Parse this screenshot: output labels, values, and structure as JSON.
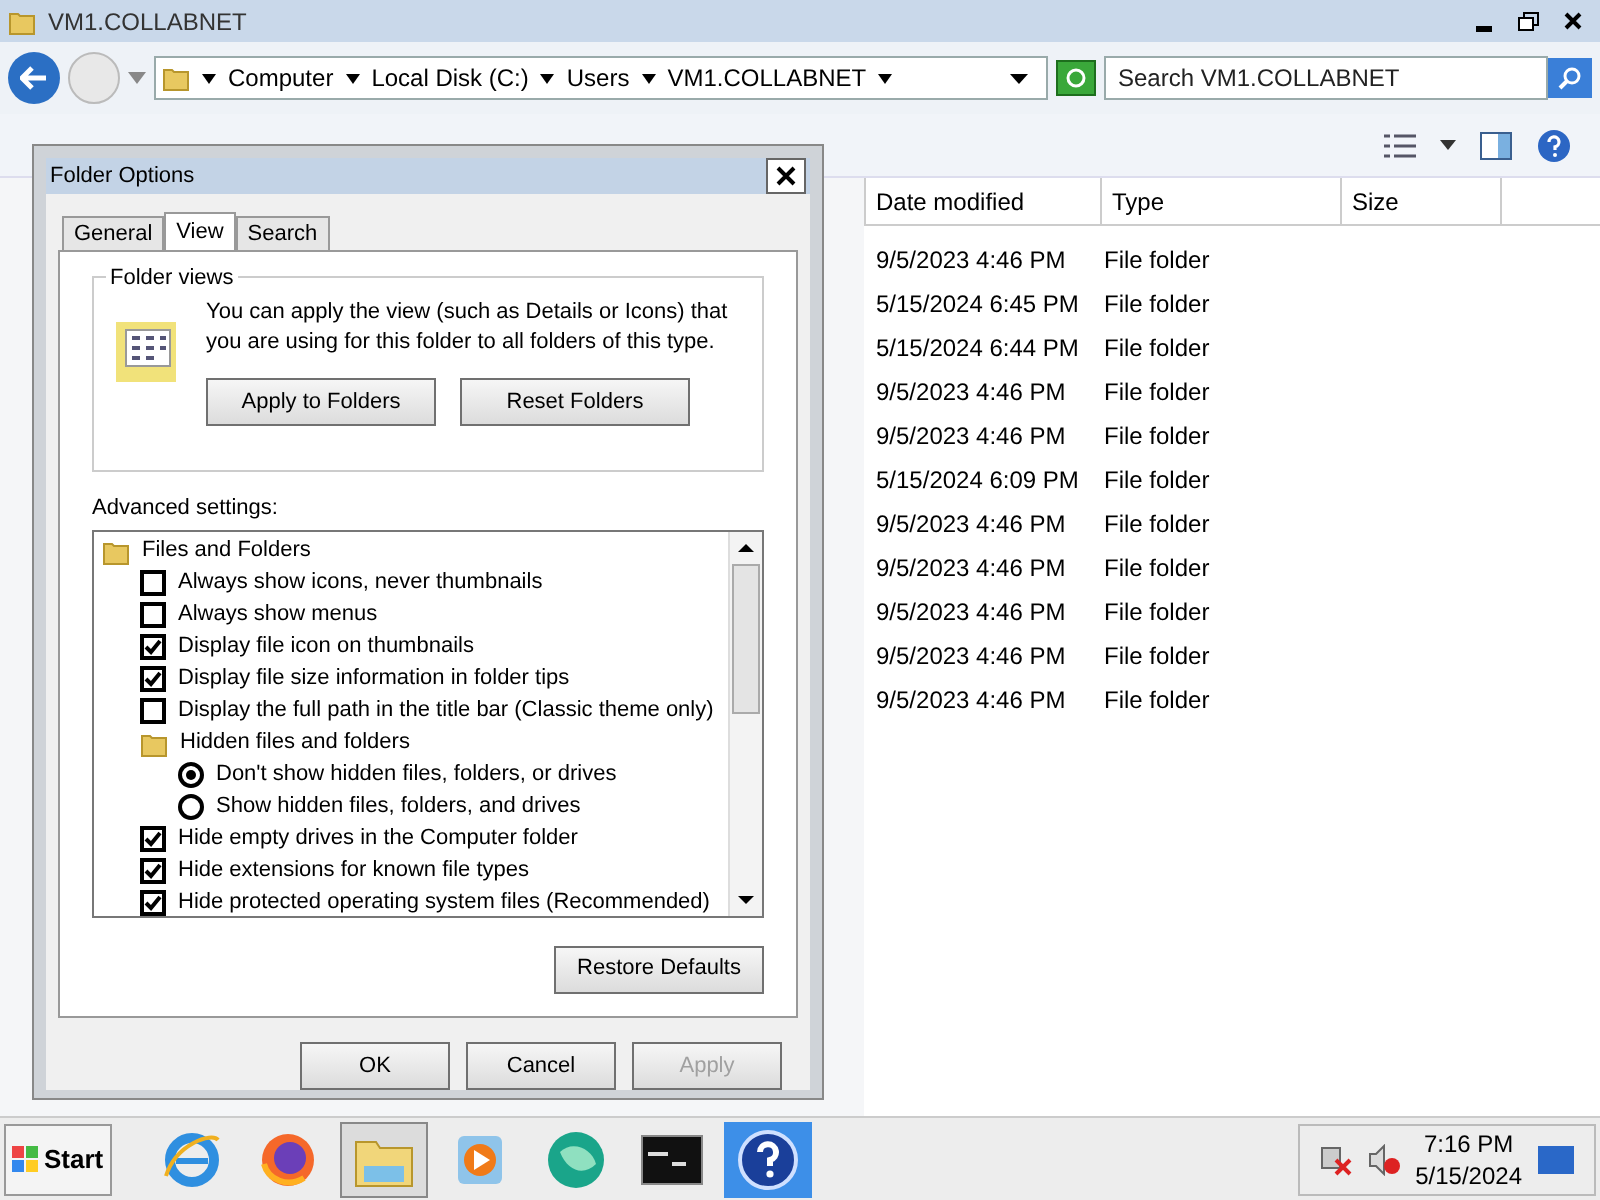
{
  "window": {
    "title": "VM1.COLLABNET"
  },
  "address": {
    "crumbs": [
      "Computer",
      "Local Disk (C:)",
      "Users",
      "VM1.COLLABNET"
    ],
    "search": {
      "placeholder": "Search VM1.COLLABNET"
    }
  },
  "table": {
    "columns": [
      "Date modified",
      "Type",
      "Size"
    ],
    "rows": [
      {
        "date": "9/5/2023 4:46 PM",
        "type": "File folder"
      },
      {
        "date": "5/15/2024 6:45 PM",
        "type": "File folder"
      },
      {
        "date": "5/15/2024 6:44 PM",
        "type": "File folder"
      },
      {
        "date": "9/5/2023 4:46 PM",
        "type": "File folder"
      },
      {
        "date": "9/5/2023 4:46 PM",
        "type": "File folder"
      },
      {
        "date": "5/15/2024 6:09 PM",
        "type": "File folder"
      },
      {
        "date": "9/5/2023 4:46 PM",
        "type": "File folder"
      },
      {
        "date": "9/5/2023 4:46 PM",
        "type": "File folder"
      },
      {
        "date": "9/5/2023 4:46 PM",
        "type": "File folder"
      },
      {
        "date": "9/5/2023 4:46 PM",
        "type": "File folder"
      },
      {
        "date": "9/5/2023 4:46 PM",
        "type": "File folder"
      }
    ]
  },
  "dialog": {
    "title": "Folder Options",
    "tabs": [
      {
        "label": "General",
        "selected": false
      },
      {
        "label": "View",
        "selected": true
      },
      {
        "label": "Search",
        "selected": false
      }
    ],
    "folder_views": {
      "legend": "Folder views",
      "description": "You can apply the view (such as Details or Icons) that you are using for this folder to all folders of this type.",
      "buttons": [
        "Apply to Folders",
        "Reset Folders"
      ]
    },
    "advanced_label": "Advanced settings:",
    "settings": [
      {
        "kind": "folder",
        "label": "Files and Folders",
        "children": [
          {
            "kind": "checkbox",
            "label": "Always show icons, never thumbnails",
            "checked": false
          },
          {
            "kind": "checkbox",
            "label": "Always show menus",
            "checked": false
          },
          {
            "kind": "checkbox",
            "label": "Display file icon on thumbnails",
            "checked": true
          },
          {
            "kind": "checkbox",
            "label": "Display file size information in folder tips",
            "checked": true
          },
          {
            "kind": "checkbox",
            "label": "Display the full path in the title bar (Classic theme only)",
            "checked": false
          },
          {
            "kind": "folder",
            "label": "Hidden files and folders",
            "children": [
              {
                "kind": "radio",
                "label": "Don't show hidden files, folders, or drives",
                "selected": true
              },
              {
                "kind": "radio",
                "label": "Show hidden files, folders, and drives",
                "selected": false
              }
            ]
          },
          {
            "kind": "checkbox",
            "label": "Hide empty drives in the Computer folder",
            "checked": true
          },
          {
            "kind": "checkbox",
            "label": "Hide extensions for known file types",
            "checked": true
          },
          {
            "kind": "checkbox",
            "label": "Hide protected operating system files (Recommended)",
            "checked": true
          }
        ]
      }
    ],
    "restore_button": "Restore Defaults",
    "footer_buttons": [
      {
        "label": "OK",
        "disabled": false
      },
      {
        "label": "Cancel",
        "disabled": false
      },
      {
        "label": "Apply",
        "disabled": true
      }
    ]
  },
  "taskbar": {
    "start": "Start",
    "apps": [
      {
        "kind": "browser-e",
        "selected": false
      },
      {
        "kind": "fox",
        "selected": false
      },
      {
        "kind": "explorer",
        "selected": true
      },
      {
        "kind": "media",
        "selected": false
      },
      {
        "kind": "orb",
        "selected": false
      },
      {
        "kind": "console",
        "selected": false
      },
      {
        "kind": "help",
        "selected": false
      }
    ],
    "time": "7:16 PM",
    "date": "5/15/2024"
  }
}
